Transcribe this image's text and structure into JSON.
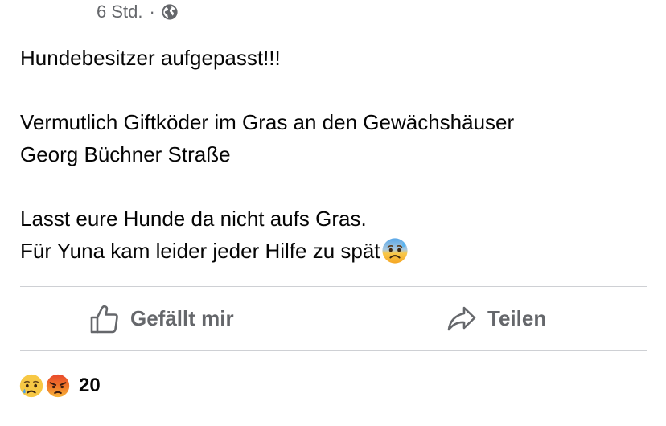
{
  "post": {
    "timestamp": "6 Std.",
    "separator": "·",
    "audience_icon": "globe-icon",
    "lines": [
      "Hundebesitzer aufgepasst!!!",
      "Vermutlich Giftköder im Gras an den Gewächshäuser",
      "Georg Büchner Straße",
      "Lasst eure Hunde da nicht aufs Gras.",
      "Für Yuna kam leider jeder Hilfe zu spät"
    ],
    "trailing_emoji": "anxious-face-with-sweat-emoji"
  },
  "actions": {
    "like_label": "Gefällt mir",
    "like_icon": "thumbs-up-icon",
    "share_label": "Teilen",
    "share_icon": "share-arrow-icon"
  },
  "reactions": {
    "icons": [
      "sad-reaction-icon",
      "angry-reaction-icon"
    ],
    "count": "20"
  },
  "colors": {
    "text": "#050505",
    "secondary_text": "#65676b",
    "divider": "#ced0d4"
  }
}
